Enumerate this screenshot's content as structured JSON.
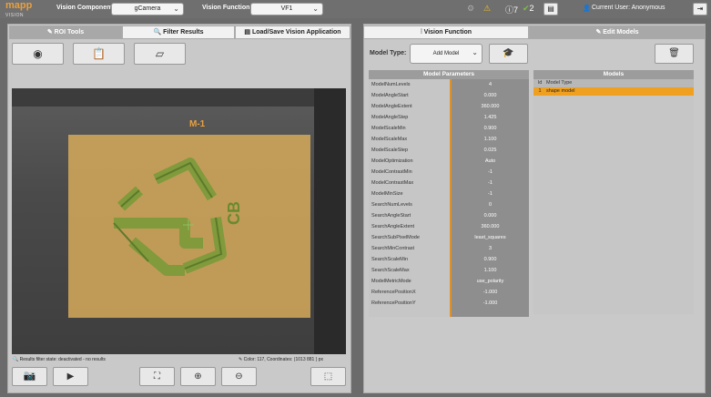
{
  "topbar": {
    "logo": "mapp",
    "logo_sub": "VISION",
    "vision_component_label": "Vision Component:",
    "vision_component_value": "gCamera",
    "vision_function_label": "Vision Function:",
    "vision_function_value": "VF1",
    "info_count": "7",
    "ok_count": "2",
    "current_user": "Current User: Anonymous"
  },
  "left": {
    "tabs": [
      {
        "label": "ROI Tools"
      },
      {
        "label": "Filter Results"
      },
      {
        "label": "Load/Save Vision Application"
      }
    ],
    "roi_label": "M-1",
    "status_left": "Results filter state: deactivated - no results",
    "status_right": "Color:  117, Coordinates: (1013   881 ) px"
  },
  "right": {
    "tabs": [
      {
        "label": "Vision Function"
      },
      {
        "label": "Edit Models"
      }
    ],
    "model_type_label": "Model Type:",
    "model_type_value": "Add Model",
    "params_header": "Model Parameters",
    "params": [
      {
        "k": "ModelNumLevels",
        "v": "4"
      },
      {
        "k": "ModelAngleStart",
        "v": "0.000"
      },
      {
        "k": "ModelAngleExtent",
        "v": "360.000"
      },
      {
        "k": "ModelAngleStep",
        "v": "1.425"
      },
      {
        "k": "ModelScaleMin",
        "v": "0.900"
      },
      {
        "k": "ModelScaleMax",
        "v": "1.100"
      },
      {
        "k": "ModelScaleStep",
        "v": "0.025"
      },
      {
        "k": "ModelOptimization",
        "v": "Auto"
      },
      {
        "k": "ModelContrastMin",
        "v": "-1"
      },
      {
        "k": "ModelContrastMax",
        "v": "-1"
      },
      {
        "k": "ModelMinSize",
        "v": "-1"
      },
      {
        "k": "SearchNumLevels",
        "v": "0"
      },
      {
        "k": "SearchAngleStart",
        "v": "0.000"
      },
      {
        "k": "SearchAngleExtent",
        "v": "360.000"
      },
      {
        "k": "SearchSubPixelMode",
        "v": "least_squares"
      },
      {
        "k": "SearchMinContrast",
        "v": "3"
      },
      {
        "k": "SearchScaleMin",
        "v": "0.900"
      },
      {
        "k": "SearchScaleMax",
        "v": "1.100"
      },
      {
        "k": "ModelMetricMode",
        "v": "use_polarity"
      },
      {
        "k": "ReferencePositionX",
        "v": "-1.000"
      },
      {
        "k": "ReferencePositionY",
        "v": "-1.000"
      }
    ],
    "models_header": "Models",
    "models_cols": {
      "id": "Id",
      "type": "Model Type"
    },
    "models": [
      {
        "id": "1",
        "type": "shape model"
      }
    ]
  },
  "colors": {
    "accent": "#e8a040",
    "selected": "#f0a020"
  }
}
